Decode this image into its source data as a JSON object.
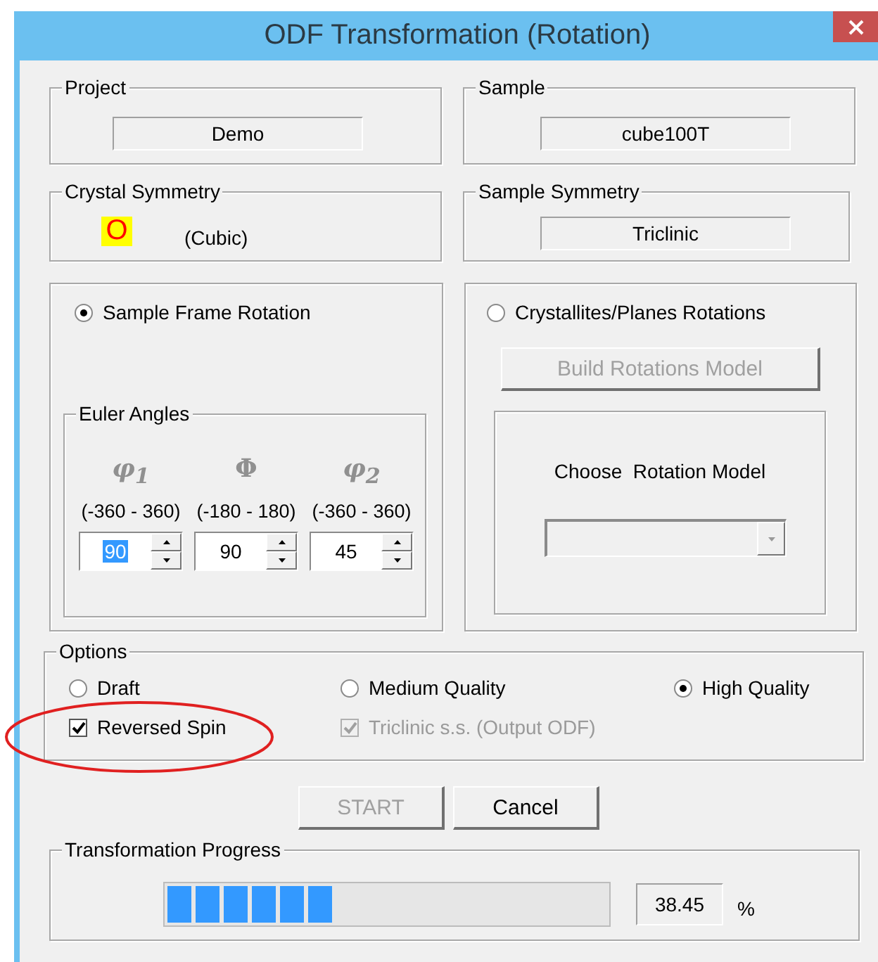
{
  "window": {
    "title": "ODF Transformation (Rotation)"
  },
  "project": {
    "label": "Project",
    "value": "Demo"
  },
  "sample": {
    "label": "Sample",
    "value": "cube100T"
  },
  "crystal_symmetry": {
    "label": "Crystal Symmetry",
    "symbol": "O",
    "name": "(Cubic)"
  },
  "sample_symmetry": {
    "label": "Sample Symmetry",
    "value": "Triclinic"
  },
  "rotation_modes": [
    {
      "label": "Sample Frame Rotation",
      "selected": true
    },
    {
      "label": "Crystallites/Planes Rotations",
      "selected": false
    }
  ],
  "euler_angles": {
    "label": "Euler Angles",
    "angles": [
      {
        "symbol": "φ$_{1}$",
        "range": "(-360 - 360)",
        "value": "90",
        "highlighted": true
      },
      {
        "symbol": "Φ",
        "range": "(-180 - 180)",
        "value": "90",
        "highlighted": false
      },
      {
        "symbol": "φ$_{2}$",
        "range": "(-360 - 360)",
        "value": "45",
        "highlighted": false
      }
    ]
  },
  "build_button": {
    "label": "Build Rotations Model",
    "disabled": true
  },
  "rotation_model": {
    "label": "Choose  Rotation Model",
    "disabled": true
  },
  "options": {
    "label": "Options",
    "qualities": [
      {
        "label": "Draft",
        "selected": false
      },
      {
        "label": "Medium Quality",
        "selected": false
      },
      {
        "label": "High Quality",
        "selected": true
      }
    ],
    "checkboxes": [
      {
        "label": "Reversed Spin",
        "checked": true,
        "disabled": false
      },
      {
        "label": "Triclinic s.s. (Output ODF)",
        "checked": true,
        "disabled": true
      }
    ]
  },
  "buttons": [
    {
      "label": "START",
      "disabled": true
    },
    {
      "label": "Cancel",
      "disabled": false
    }
  ],
  "progress": {
    "label": "Transformation Progress",
    "level": 0.3845,
    "reading": "38.45",
    "unit": "%"
  }
}
